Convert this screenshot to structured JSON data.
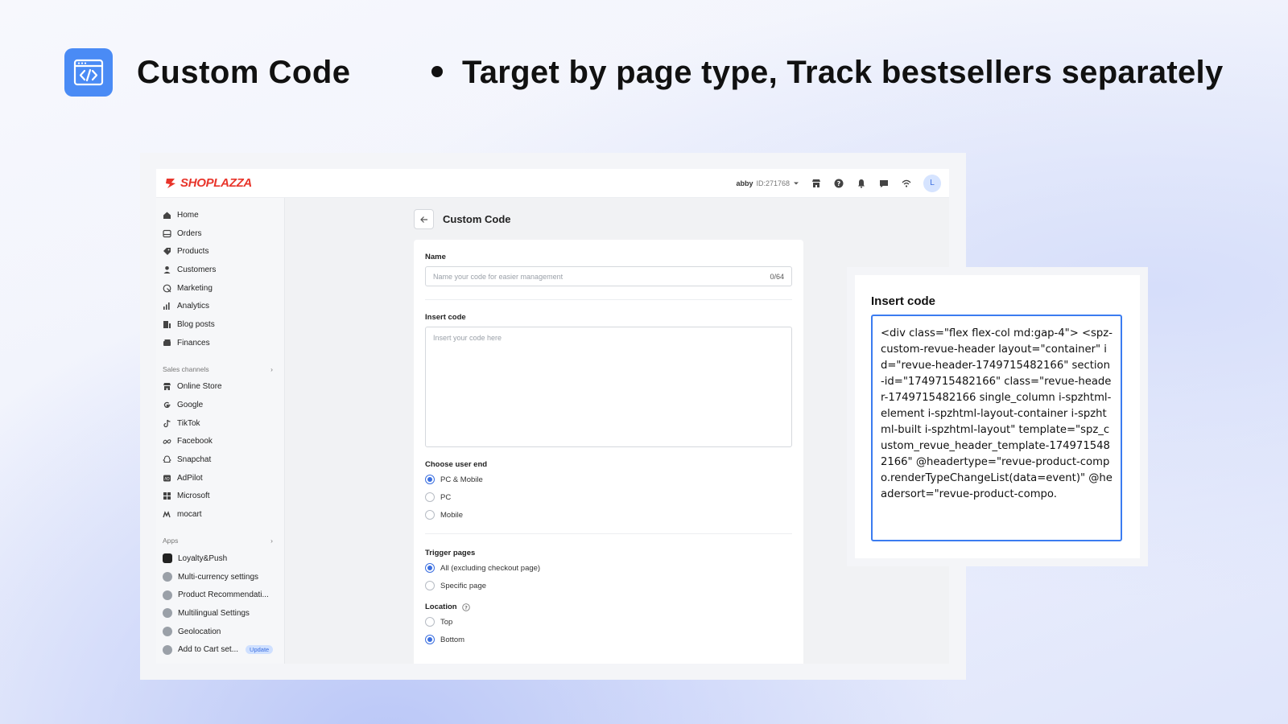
{
  "hero": {
    "title": "Custom Code",
    "subtitle": "Target by page type, Track bestsellers separately",
    "icon": "code-window-icon",
    "accent": "#4a8bf5"
  },
  "topbar": {
    "logo_text": "SHOPLAZZA",
    "store_name": "abby",
    "store_id": "ID:271768",
    "avatar_letter": "L"
  },
  "sidebar": {
    "main_items": [
      {
        "label": "Home",
        "icon": "home-icon"
      },
      {
        "label": "Orders",
        "icon": "orders-icon"
      },
      {
        "label": "Products",
        "icon": "tag-icon"
      },
      {
        "label": "Customers",
        "icon": "person-icon"
      },
      {
        "label": "Marketing",
        "icon": "marketing-icon"
      },
      {
        "label": "Analytics",
        "icon": "bar-chart-icon"
      },
      {
        "label": "Blog posts",
        "icon": "blog-icon"
      },
      {
        "label": "Finances",
        "icon": "finance-icon"
      }
    ],
    "sales_title": "Sales channels",
    "sales_items": [
      {
        "label": "Online Store",
        "icon": "store-icon"
      },
      {
        "label": "Google",
        "icon": "google-icon"
      },
      {
        "label": "TikTok",
        "icon": "tiktok-icon"
      },
      {
        "label": "Facebook",
        "icon": "meta-icon"
      },
      {
        "label": "Snapchat",
        "icon": "snapchat-icon"
      },
      {
        "label": "AdPilot",
        "icon": "adpilot-icon"
      },
      {
        "label": "Microsoft",
        "icon": "microsoft-icon"
      },
      {
        "label": "mocart",
        "icon": "mocart-icon"
      }
    ],
    "apps_title": "Apps",
    "app_items": [
      {
        "label": "Loyalty&Push"
      },
      {
        "label": "Multi-currency settings"
      },
      {
        "label": "Product Recommendati..."
      },
      {
        "label": "Multilingual Settings"
      },
      {
        "label": "Geolocation"
      },
      {
        "label": "Add to Cart set...",
        "badge": "Update"
      }
    ]
  },
  "main": {
    "title": "Custom Code",
    "name_label": "Name",
    "name_placeholder": "Name your code for easier management",
    "name_counter": "0/64",
    "code_label": "Insert code",
    "code_placeholder": "Insert your code here",
    "user_end_label": "Choose user end",
    "user_end_options": [
      {
        "label": "PC & Mobile",
        "selected": true
      },
      {
        "label": "PC",
        "selected": false
      },
      {
        "label": "Mobile",
        "selected": false
      }
    ],
    "trigger_label": "Trigger pages",
    "trigger_options": [
      {
        "label": "All (excluding checkout page)",
        "selected": true
      },
      {
        "label": "Specific page",
        "selected": false
      }
    ],
    "location_label": "Location",
    "location_options": [
      {
        "label": "Top",
        "selected": false
      },
      {
        "label": "Bottom",
        "selected": true
      }
    ]
  },
  "popout": {
    "label": "Insert code",
    "code": "<div class=\"flex flex-col md:gap-4\"> <spz-custom-revue-header layout=\"container\" id=\"revue-header-1749715482166\" section-id=\"1749715482166\" class=\"revue-header-1749715482166 single_column i-spzhtml-element i-spzhtml-layout-container i-spzhtml-built i-spzhtml-layout\" template=\"spz_custom_revue_header_template-1749715482166\" @headertype=\"revue-product-compo.renderTypeChangeList(data=event)\" @headersort=\"revue-product-compo."
  }
}
